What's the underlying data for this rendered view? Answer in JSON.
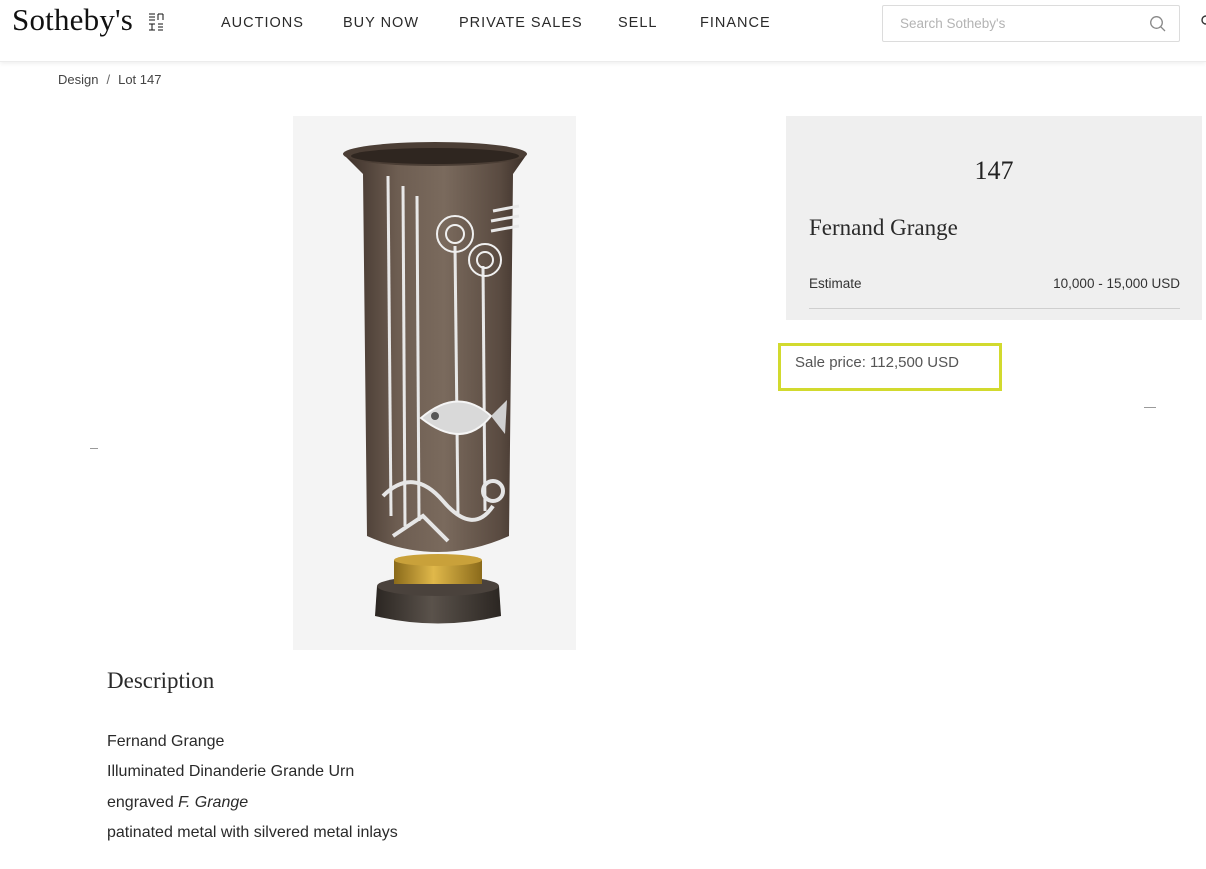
{
  "header": {
    "logo": "Sotheby's",
    "logo_est": "EST 1744",
    "nav": [
      "AUCTIONS",
      "BUY NOW",
      "PRIVATE SALES",
      "SELL",
      "FINANCE"
    ],
    "search_placeholder": "Search Sotheby's",
    "search_icon": "search-icon"
  },
  "breadcrumb": {
    "items": [
      "Design",
      "Lot 147"
    ],
    "separator": "/"
  },
  "lot": {
    "number": "147",
    "artist": "Fernand Grange",
    "estimate_label": "Estimate",
    "estimate_value": "10,000 - 15,000 USD",
    "sale_price": "Sale price: 112,500 USD",
    "highlight_color": "#d2da2e"
  },
  "description": {
    "title": "Description",
    "lines": [
      "Fernand Grange",
      "Illuminated Dinanderie Grande Urn",
      "engraved ",
      "patinated metal with silvered metal inlays"
    ],
    "signature_italic": "F. Grange"
  }
}
